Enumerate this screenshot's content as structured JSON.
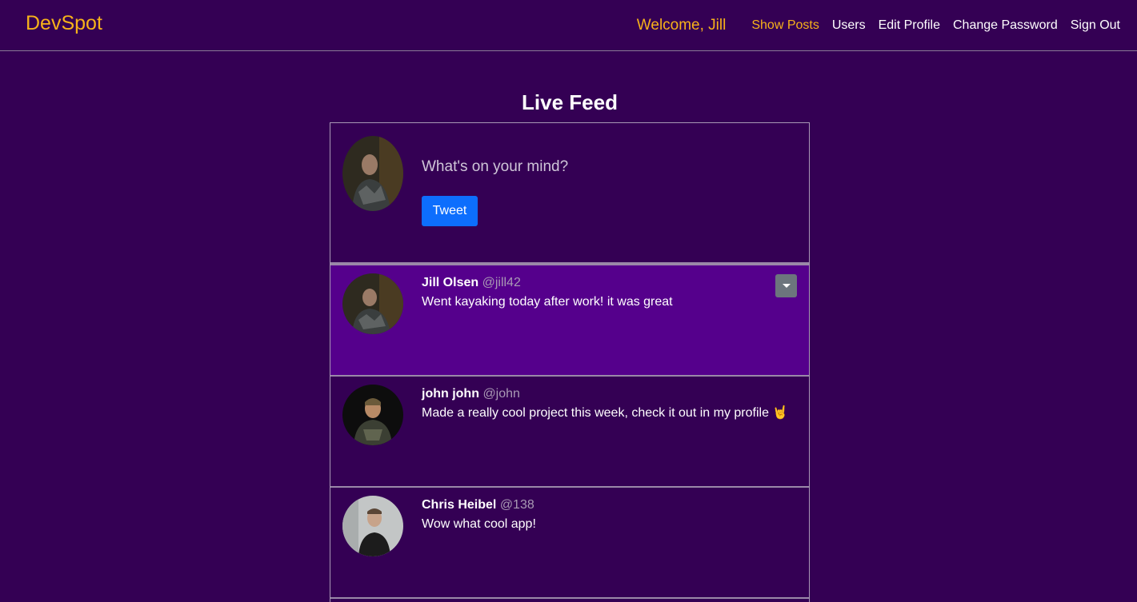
{
  "navbar": {
    "brand": "DevSpot",
    "welcome": "Welcome, Jill",
    "links": [
      {
        "label": "Show Posts",
        "active": true
      },
      {
        "label": "Users"
      },
      {
        "label": "Edit Profile"
      },
      {
        "label": "Change Password"
      },
      {
        "label": "Sign Out"
      }
    ]
  },
  "feed": {
    "title": "Live Feed",
    "composer": {
      "placeholder": "What's on your mind?",
      "button_label": "Tweet"
    },
    "posts": [
      {
        "name": "Jill Olsen",
        "handle": "@jill42",
        "text": "Went kayaking today after work! it was great"
      },
      {
        "name": "john john",
        "handle": "@john",
        "text": "Made a really cool project this week, check it out in my profile 🤘"
      },
      {
        "name": "Chris Heibel",
        "handle": "@138",
        "text": "Wow what cool app!"
      }
    ]
  },
  "colors": {
    "background": "#340054",
    "accent": "#f7b21a",
    "highlight_row": "#55008c",
    "primary_button": "#0d6efd"
  }
}
